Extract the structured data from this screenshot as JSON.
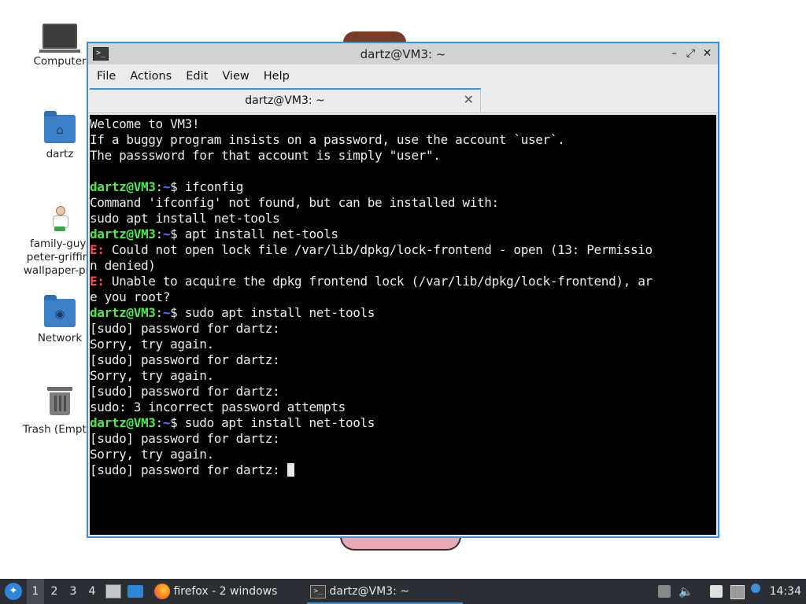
{
  "desktop": {
    "icons": [
      {
        "label": "Computer"
      },
      {
        "label": "dartz"
      },
      {
        "label_lines": [
          "family-guy-",
          "peter-griffin-",
          "wallpaper-pre"
        ]
      },
      {
        "label": "Network"
      },
      {
        "label": "Trash (Empty)"
      }
    ]
  },
  "window": {
    "title": "dartz@VM3: ~",
    "controls": {
      "minimize": "–",
      "maximize": "⤢",
      "close": "✕"
    },
    "menu": [
      "File",
      "Actions",
      "Edit",
      "View",
      "Help"
    ],
    "tab": {
      "label": "dartz@VM3: ~",
      "close": "✕"
    }
  },
  "terminal": {
    "prompt": {
      "user": "dartz@VM3",
      "sep": ":",
      "path": "~",
      "sigil": "$ "
    },
    "lines": {
      "l1": "Welcome to VM3!",
      "l2": "If a buggy program insists on a password, use the account `user`.",
      "l3": "The passsword for that account is simply \"user\".",
      "cmd1": "ifconfig",
      "l6": "Command 'ifconfig' not found, but can be installed with:",
      "l7": "sudo apt install net-tools",
      "cmd2": "apt install net-tools",
      "err_tag": "E:",
      "l9": " Could not open lock file /var/lib/dpkg/lock-frontend - open (13: Permissio",
      "l10": "n denied)",
      "l11": " Unable to acquire the dpkg frontend lock (/var/lib/dpkg/lock-frontend), ar",
      "l12": "e you root?",
      "cmd3": "sudo apt install net-tools",
      "pw": "[sudo] password for dartz:",
      "sorry": "Sorry, try again.",
      "fail": "sudo: 3 incorrect password attempts",
      "cmd4": "sudo apt install net-tools",
      "pw_last": "[sudo] password for dartz: "
    }
  },
  "taskbar": {
    "workspaces": [
      "1",
      "2",
      "3",
      "4"
    ],
    "active_workspace": "1",
    "tasks": [
      {
        "label": "firefox - 2 windows",
        "icon": "firefox-icon"
      },
      {
        "label": "dartz@VM3: ~",
        "icon": "terminal-icon"
      }
    ],
    "clock": "14:34"
  },
  "colors": {
    "accent": "#3d8fd9",
    "prompt_user": "#54e454",
    "prompt_path": "#5a78ff",
    "error": "#ff4e4e",
    "taskbar_bg": "#2b2e33"
  }
}
